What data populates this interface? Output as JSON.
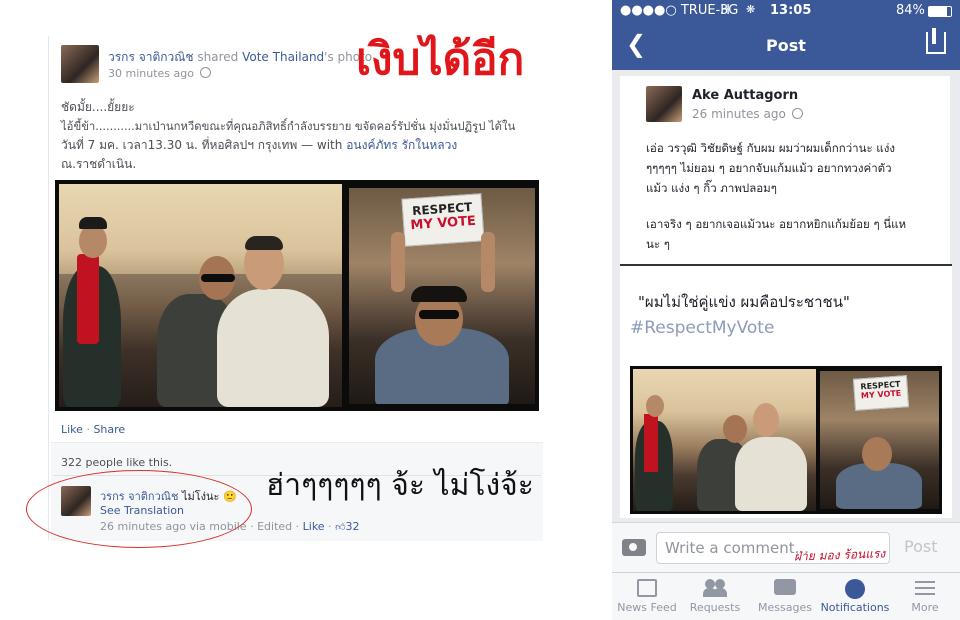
{
  "overlay": {
    "title_text": "เงิบได้อีก",
    "laugh_text": "ฮ่าๆๆๆๆๆ จ้ะ ไม่โง่จ้ะ",
    "signature_text": "ฝ่าย มอง ร้อนแรง"
  },
  "left_post": {
    "author": "วรกร จาติกวณิช",
    "shared_text": "shared",
    "source_page": "Vote Thailand",
    "source_suffix": "'s photo.",
    "time": "30 minutes ago",
    "line1": "ชัดมั้ย....ยั้ยยะ",
    "line2": "ไอ้ขี้ข้า...........มาเป่านกหวีดขณะที่คุณอภิสิทธิ์กำลังบรรยาย ขจัดคอร์รัปชั่น มุ่งมั่นปฏิรูป ได้ใน",
    "line3_prefix": "วันที่ 7 มค. เวลา13.30 น. ที่หอศิลปฯ กรุงเทพ — with",
    "tagged1": "อนงค์ภัทร รักในหลวง",
    "line4": "ณ.ราชดำเนิน.",
    "sign_line1": "RESPECT",
    "sign_line2": "MY VOTE",
    "like_label": "Like",
    "dot": "·",
    "share_label": "Share",
    "likes_count": "322 people like this.",
    "comment": {
      "author": "วรกร จาติกวณิช",
      "text": "ไม่โง่นะ",
      "emoji": "🙂",
      "see_translation": "See Translation",
      "time": "26 minutes ago via mobile",
      "edited": "Edited",
      "like_label": "Like",
      "like_count": "32"
    }
  },
  "phone": {
    "carrier": "●●●●○ TRUE-H",
    "network": "3G",
    "clock": "13:05",
    "battery": "84%",
    "nav_title": "Post",
    "post": {
      "author": "Ake Auttagorn",
      "time": "26 minutes ago",
      "text1": "เอ่อ วรวุฒิ วิชัยดิษฐ์ กับผม ผมว่าผมเด็กกว่านะ แง่ง",
      "text2": "ๆๆๆๆๆ ไม่ยอม ๆ อยากจับแก้มแม้ว อยากทวงค่าตัว",
      "text3": "แม้ว แง่ง ๆ กิ๊ว ภาพปลอมๆ",
      "text4": "เอาจริง ๆ อยากเจอแม้วนะ อยากหยิกแก้มย้อย ๆ นี่แห",
      "text5": "นะ ๆ"
    },
    "shared_quote": "\"ผมไม่ใช่คู่แข่ง ผมคือประชาชน\"",
    "hashtag": "#RespectMyVote",
    "sign_line1": "RESPECT",
    "sign_line2": "MY VOTE",
    "comment_placeholder": "Write a comment...",
    "post_button": "Post",
    "tabs": [
      {
        "label": "News Feed"
      },
      {
        "label": "Requests"
      },
      {
        "label": "Messages"
      },
      {
        "label": "Notifications"
      },
      {
        "label": "More"
      }
    ],
    "accent": "#3b5998",
    "active_tab_color": "#3b5998"
  }
}
